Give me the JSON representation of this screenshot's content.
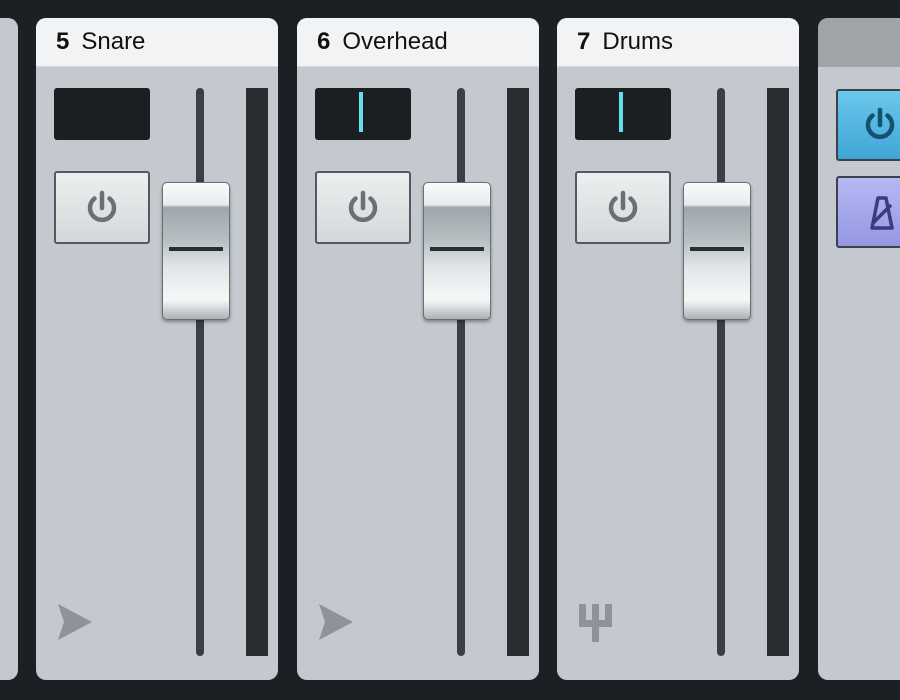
{
  "mixer": {
    "channels": [
      {
        "number": "5",
        "name": "Snare",
        "display_cursor": false,
        "type_icon": "send-arrow-icon"
      },
      {
        "number": "6",
        "name": "Overhead",
        "display_cursor": true,
        "type_icon": "send-arrow-icon"
      },
      {
        "number": "7",
        "name": "Drums",
        "display_cursor": true,
        "type_icon": "instrument-fork-icon"
      }
    ],
    "partial_strip": {
      "buttons": [
        "power-icon",
        "metronome-icon"
      ]
    }
  },
  "colors": {
    "background": "#1c2024",
    "strip_body": "#c3c9ce",
    "strip_header": "#f2f3f4",
    "display_cursor": "#5fe0ec",
    "power_blue": "#4fb5e2",
    "metronome_purple": "#a4a6ec"
  }
}
